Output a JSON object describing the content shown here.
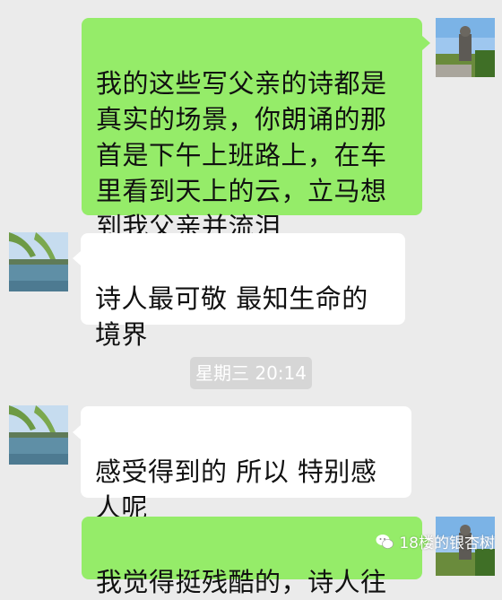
{
  "messages": [
    {
      "side": "out",
      "text": "我的这些写父亲的诗都是\n真实的场景，你朗诵的那\n首是下午上班路上，在车\n里看到天上的云，立马想\n到我父亲并流泪"
    },
    {
      "side": "in",
      "text": "诗人最可敬  最知生命的\n境界"
    },
    {
      "side": "in",
      "text": "感受得到的  所以 特别感\n人呢"
    },
    {
      "side": "out",
      "text": "我觉得挺残酷的，诗人往"
    }
  ],
  "timestamp": "星期三 20:14",
  "watermark": {
    "text": "18楼的银杏树",
    "icon": "wechat-icon"
  },
  "colors": {
    "background": "#ebebeb",
    "outgoing_bubble": "#95ec69",
    "incoming_bubble": "#ffffff",
    "time_pill": "#d6d6d6"
  }
}
